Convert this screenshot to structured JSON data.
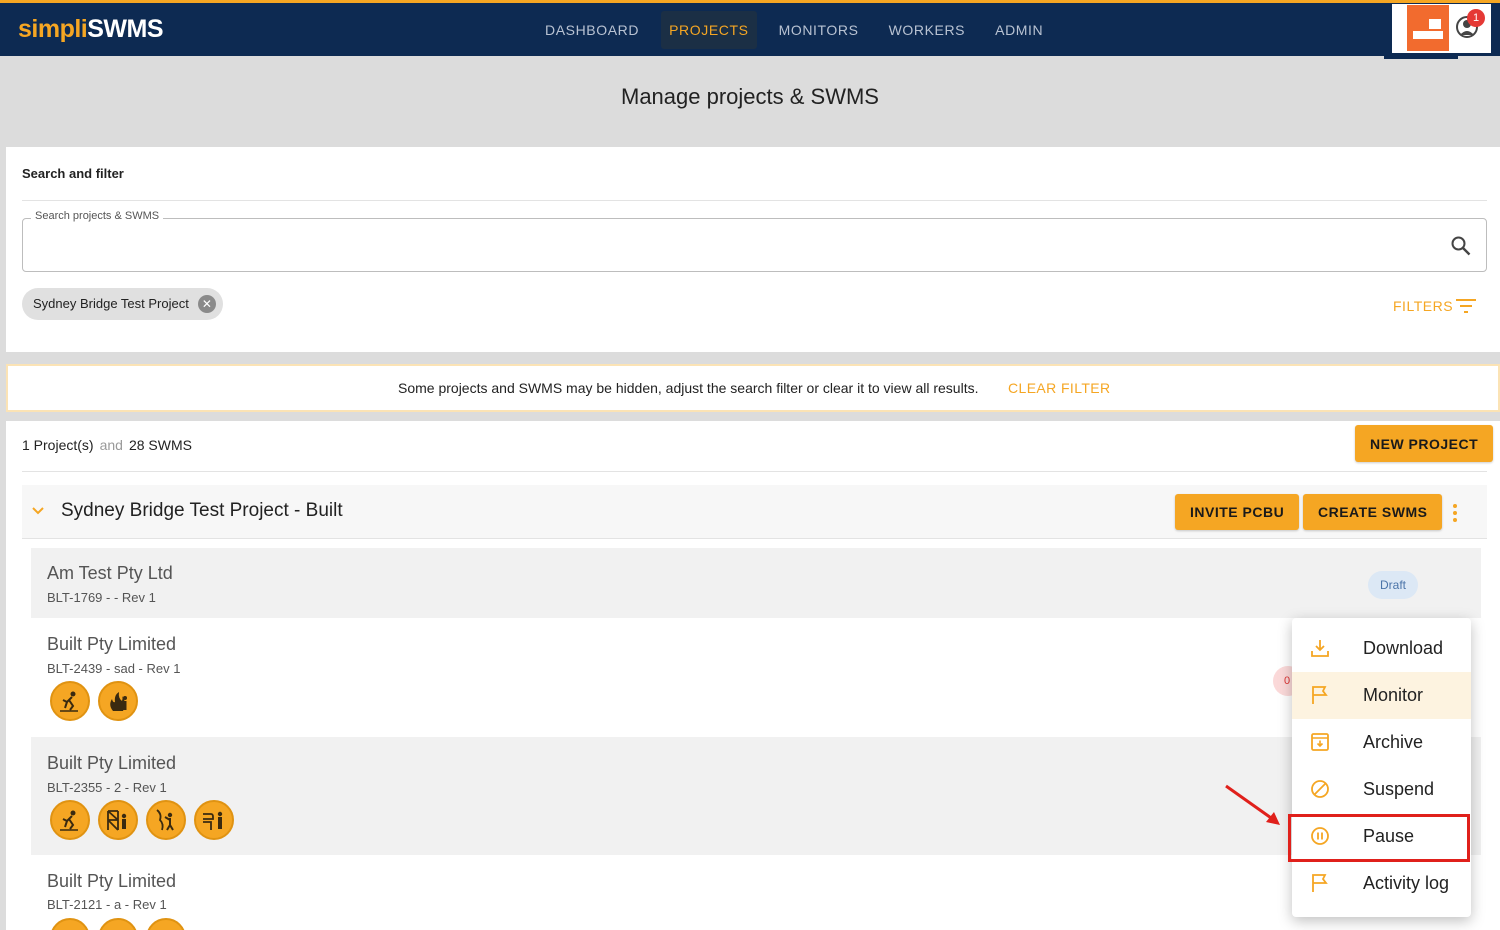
{
  "header": {
    "logo_part1": "simpli",
    "logo_part2": "SWMS",
    "nav": [
      "DASHBOARD",
      "PROJECTS",
      "MONITORS",
      "WORKERS",
      "ADMIN"
    ],
    "active_nav": "PROJECTS",
    "notification_count": "1"
  },
  "page": {
    "title": "Manage projects & SWMS"
  },
  "search": {
    "section_title": "Search and filter",
    "label": "Search projects & SWMS",
    "value": "",
    "chip": "Sydney Bridge Test Project",
    "filters_label": "FILTERS"
  },
  "notice": {
    "text": "Some projects and SWMS may be hidden, adjust the search filter or clear it to view all results.",
    "clear_label": "CLEAR FILTER"
  },
  "results": {
    "projects_count": "1 Project(s)",
    "and": "and",
    "swms_count": "28 SWMS",
    "new_project": "NEW PROJECT"
  },
  "project": {
    "title": "Sydney Bridge Test Project - Built",
    "invite": "INVITE PCBU",
    "create": "CREATE SWMS",
    "rows": [
      {
        "name": "Am Test Pty Ltd",
        "code": "BLT-1769 - - Rev 1",
        "status": "Draft"
      },
      {
        "name": "Built Pty Limited",
        "code": "BLT-2439 - sad - Rev 1",
        "hazards": [
          "fall-hazard-icon",
          "fire-hazard-icon"
        ]
      },
      {
        "name": "Built Pty Limited",
        "code": "BLT-2355 - 2 - Rev 1",
        "hazards": [
          "fall-hazard-icon",
          "scaffold-hazard-icon",
          "electrical-hazard-icon",
          "confined-space-icon"
        ]
      },
      {
        "name": "Built Pty Limited",
        "code": "BLT-2121 - a - Rev 1"
      }
    ],
    "partial_badge": "0"
  },
  "menu": {
    "items": [
      {
        "label": "Download",
        "icon": "download-icon"
      },
      {
        "label": "Monitor",
        "icon": "flag-icon"
      },
      {
        "label": "Archive",
        "icon": "archive-icon"
      },
      {
        "label": "Suspend",
        "icon": "block-icon"
      },
      {
        "label": "Pause",
        "icon": "pause-icon"
      },
      {
        "label": "Activity log",
        "icon": "flag-icon"
      }
    ],
    "hovered": "Monitor",
    "highlighted": "Pause"
  },
  "colors": {
    "navy": "#0d2a52",
    "accent": "#f5a623",
    "highlight": "#e0201b"
  }
}
